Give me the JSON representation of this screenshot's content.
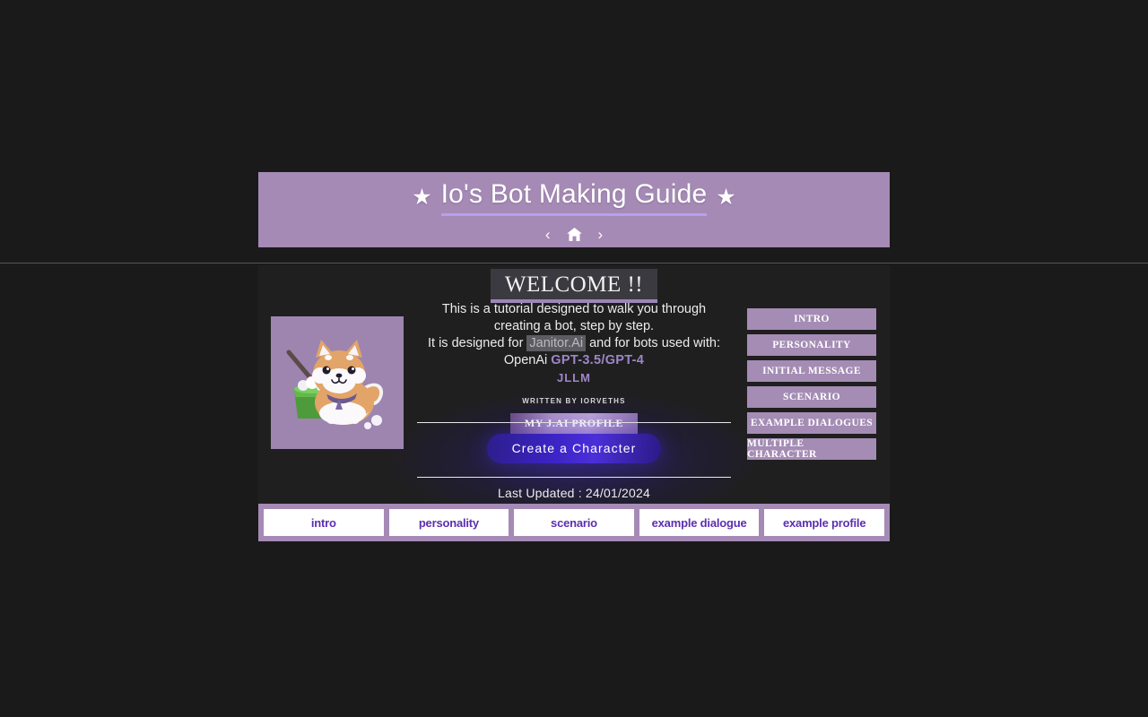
{
  "header": {
    "star_left": "★",
    "star_right": "★",
    "title": "Io's Bot Making Guide",
    "nav": {
      "back_label": "‹",
      "home_icon": "home-icon",
      "forward_label": "›"
    }
  },
  "main": {
    "welcome_heading": "WELCOME !!",
    "intro_line_1": "This is a tutorial designed to walk you through",
    "intro_line_2": "creating a bot, step by step.",
    "designed_prefix": "It is designed for ",
    "designed_chip": "Janitor.Ai",
    "designed_suffix": " and for bots used with:",
    "openai_prefix": "OpenAi ",
    "openai_models": "GPT-3.5/GPT-4",
    "jllm": "JLLM",
    "written_by": "WRITTEN BY IORVETHS",
    "profile_button": "MY J.AI PROFILE",
    "cta_button": "Create a Character",
    "last_updated": "Last Updated : 24/01/2024",
    "image_alt": "shiba-inu-with-mop-bucket"
  },
  "sidebar": {
    "items": [
      {
        "label": "INTRO"
      },
      {
        "label": "PERSONALITY"
      },
      {
        "label": "INITIAL MESSAGE"
      },
      {
        "label": "SCENARIO"
      },
      {
        "label": "EXAMPLE DIALOGUES"
      },
      {
        "label": "MULTIPLE CHARACTER"
      }
    ]
  },
  "bottom_tabs": {
    "items": [
      {
        "label": "intro"
      },
      {
        "label": "personality"
      },
      {
        "label": "scenario"
      },
      {
        "label": "example dialogue"
      },
      {
        "label": "example profile"
      }
    ]
  },
  "colors": {
    "page_background": "#1a1a1a",
    "panel_background": "#1f1f1f",
    "banner_purple": "#a58ab5",
    "accent_purple": "#9f86c9",
    "title_underline": "#b79ff0",
    "cta_blue": "#3a24c4",
    "tab_text": "#5b2fb0"
  }
}
